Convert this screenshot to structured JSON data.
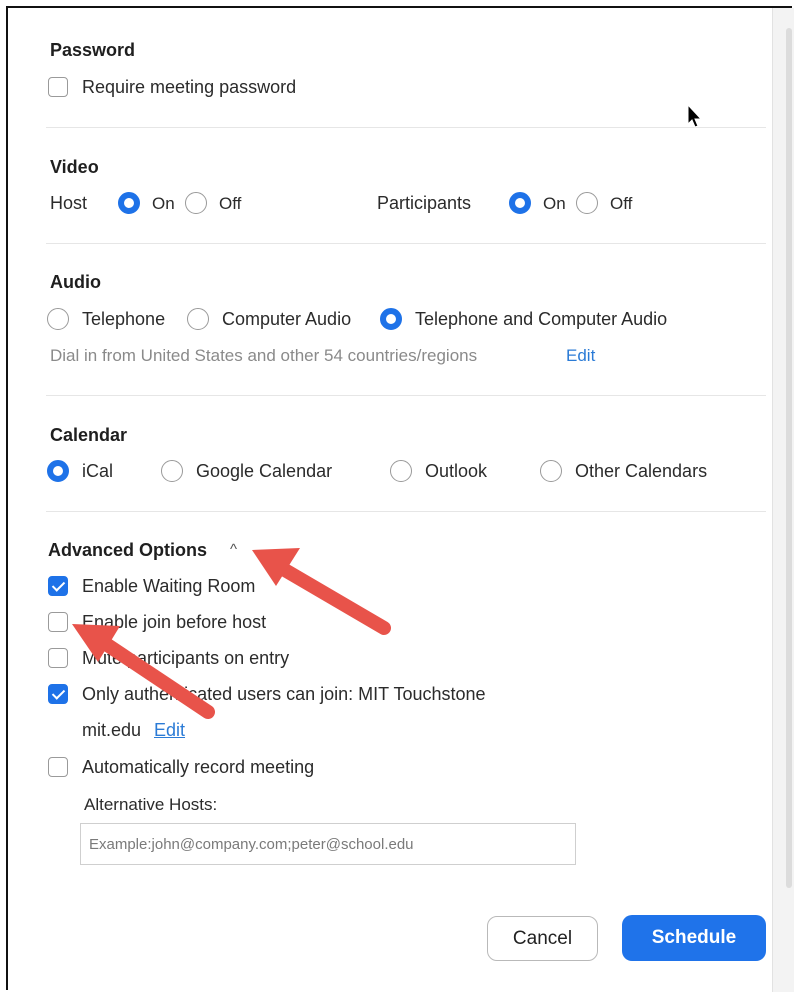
{
  "password": {
    "title": "Password",
    "require_label": "Require meeting password",
    "require_checked": false
  },
  "video": {
    "title": "Video",
    "host_label": "Host",
    "participants_label": "Participants",
    "on_label": "On",
    "off_label": "Off",
    "host_value": "On",
    "participants_value": "On"
  },
  "audio": {
    "title": "Audio",
    "options": [
      "Telephone",
      "Computer Audio",
      "Telephone and Computer Audio"
    ],
    "selected": "Telephone and Computer Audio",
    "dial_in_text": "Dial in from United States and other 54 countries/regions",
    "edit_label": "Edit"
  },
  "calendar": {
    "title": "Calendar",
    "options": [
      "iCal",
      "Google Calendar",
      "Outlook",
      "Other Calendars"
    ],
    "selected": "iCal"
  },
  "advanced": {
    "title": "Advanced Options",
    "toggle_glyph": "^",
    "options": [
      {
        "label": "Enable Waiting Room",
        "checked": true
      },
      {
        "label": "Enable join before host",
        "checked": false
      },
      {
        "label": "Mute participants on entry",
        "checked": false
      },
      {
        "label": "Only authenticated users can join: MIT Touchstone",
        "checked": true
      },
      {
        "label": "Automatically record meeting",
        "checked": false
      }
    ],
    "auth_domain": "mit.edu",
    "auth_edit_label": "Edit",
    "alt_hosts_label": "Alternative Hosts:",
    "alt_hosts_placeholder": "Example:john@company.com;peter@school.edu",
    "alt_hosts_value": ""
  },
  "footer": {
    "cancel_label": "Cancel",
    "schedule_label": "Schedule"
  },
  "colors": {
    "accent": "#1e72e8",
    "annotation_arrow": "#e8534a",
    "link": "#2b7bd6"
  },
  "icons": [
    "checkbox",
    "radio-button",
    "chevron-up-icon",
    "mouse-cursor-icon",
    "annotation-arrow"
  ]
}
